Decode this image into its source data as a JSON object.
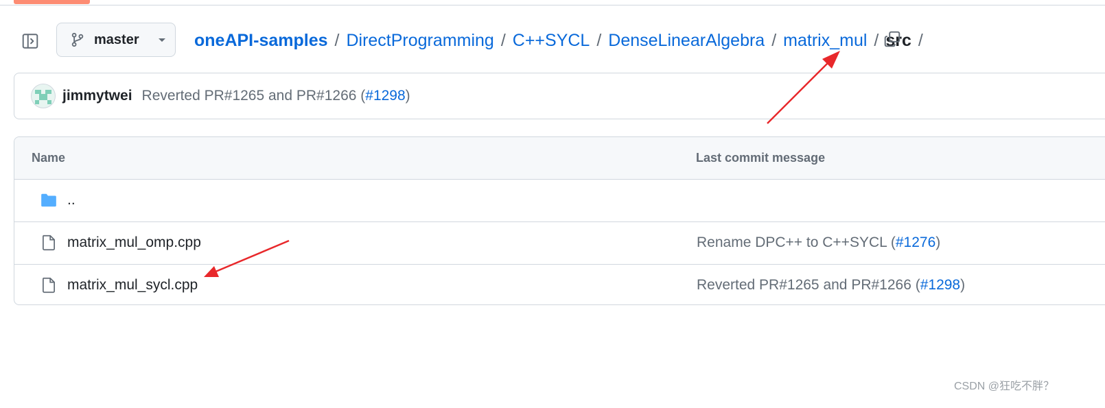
{
  "branch": {
    "name": "master"
  },
  "breadcrumb": {
    "repo": "oneAPI-samples",
    "path": [
      "DirectProgramming",
      "C++SYCL",
      "DenseLinearAlgebra",
      "matrix_mul"
    ],
    "current": "src",
    "separator": "/"
  },
  "latest_commit": {
    "author": "jimmytwei",
    "message": "Reverted PR#1265 and PR#1266 (",
    "pr_link": "#1298",
    "message_end": ")"
  },
  "file_table": {
    "columns": {
      "name": "Name",
      "last_commit": "Last commit message"
    },
    "parent_dir": "..",
    "files": [
      {
        "name": "matrix_mul_omp.cpp",
        "message": "Rename DPC++ to C++SYCL (",
        "pr_link": "#1276",
        "message_end": ")"
      },
      {
        "name": "matrix_mul_sycl.cpp",
        "message": "Reverted PR#1265 and PR#1266 (",
        "pr_link": "#1298",
        "message_end": ")"
      }
    ]
  },
  "watermark": "CSDN @狂吃不胖？",
  "colors": {
    "link": "#0969da",
    "folder": "#54aeff",
    "annotation_arrow": "#e8282b",
    "tab_indicator": "#fd8c73"
  },
  "icons": [
    "sidebar-expand-icon",
    "git-branch-icon",
    "caret-down-icon",
    "copy-icon",
    "folder-icon",
    "file-icon"
  ]
}
